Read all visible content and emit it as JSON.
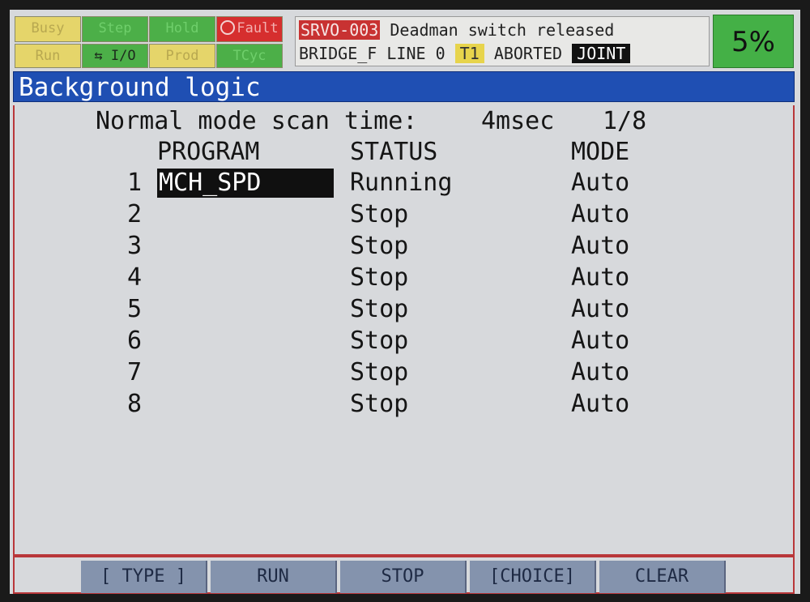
{
  "status_indicators": {
    "busy": "Busy",
    "step": "Step",
    "hold": "Hold",
    "fault": "Fault",
    "run": "Run",
    "io": "I/O",
    "prod": "Prod",
    "tcyc": "TCyc"
  },
  "alarm": {
    "code": "SRVO-003",
    "message": "Deadman switch released",
    "program": "BRIDGE_F",
    "line": "LINE 0",
    "mode_tag": "T1",
    "state": "ABORTED",
    "coord": "JOINT"
  },
  "speed": "5%",
  "screen_title": "Background logic",
  "scan": {
    "label": "Normal mode scan time:",
    "value": "4msec",
    "page": "1/8"
  },
  "table": {
    "headers": {
      "program": "PROGRAM",
      "status": "STATUS",
      "mode": "MODE"
    },
    "rows": [
      {
        "num": "1",
        "program": "MCH_SPD",
        "status": "Running",
        "mode": "Auto"
      },
      {
        "num": "2",
        "program": "",
        "status": "Stop",
        "mode": "Auto"
      },
      {
        "num": "3",
        "program": "",
        "status": "Stop",
        "mode": "Auto"
      },
      {
        "num": "4",
        "program": "",
        "status": "Stop",
        "mode": "Auto"
      },
      {
        "num": "5",
        "program": "",
        "status": "Stop",
        "mode": "Auto"
      },
      {
        "num": "6",
        "program": "",
        "status": "Stop",
        "mode": "Auto"
      },
      {
        "num": "7",
        "program": "",
        "status": "Stop",
        "mode": "Auto"
      },
      {
        "num": "8",
        "program": "",
        "status": "Stop",
        "mode": "Auto"
      }
    ]
  },
  "function_keys": [
    "[ TYPE ]",
    "RUN",
    "STOP",
    "[CHOICE]",
    "CLEAR"
  ],
  "colors": {
    "title_bar": "#1f4fb3",
    "indicator_yellow": "#e5d56a",
    "indicator_green": "#4caf48",
    "indicator_red": "#d62e2e",
    "speed_bg": "#44b046",
    "fkey_bg": "#8493ad"
  }
}
